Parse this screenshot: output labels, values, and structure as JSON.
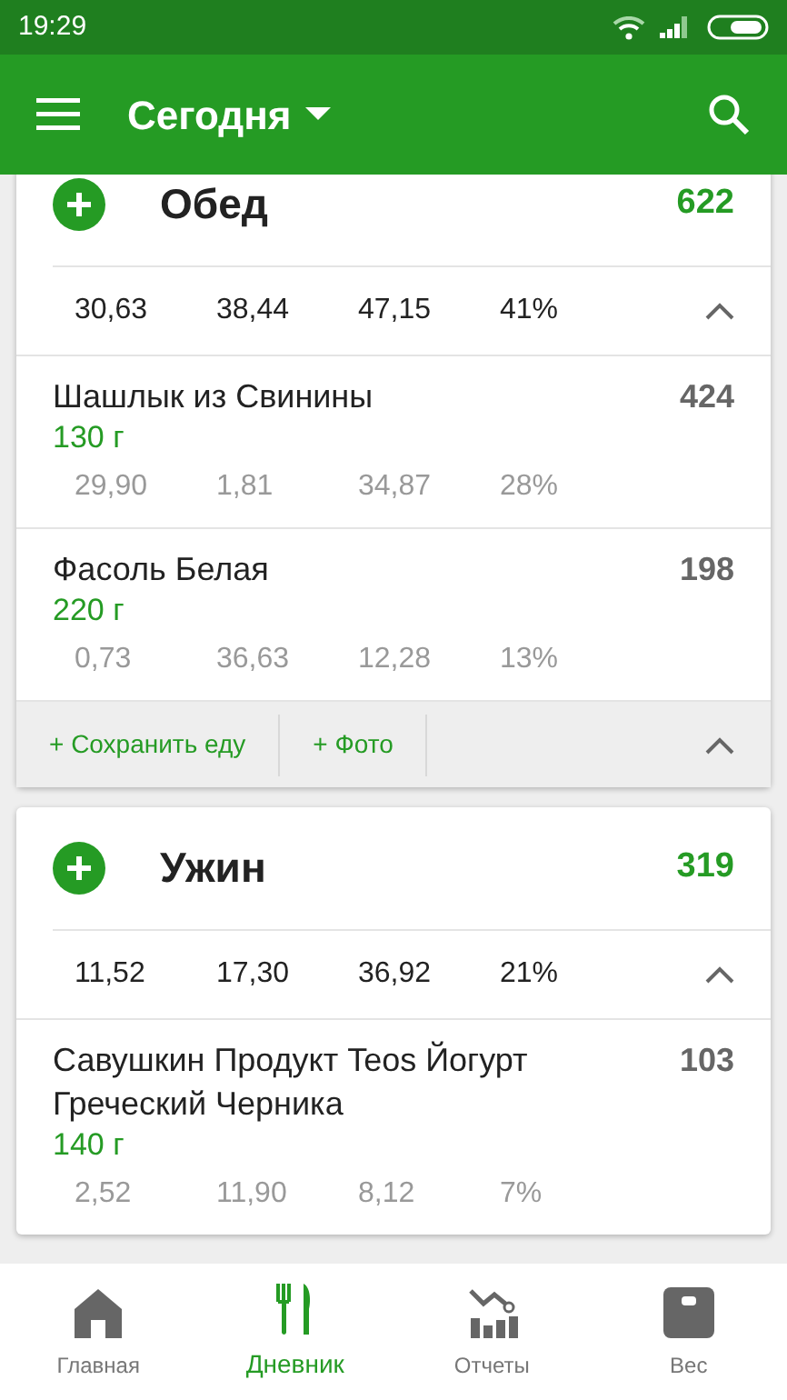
{
  "status_bar": {
    "time": "19:29"
  },
  "app_bar": {
    "title": "Сегодня"
  },
  "meals": [
    {
      "name": "Обед",
      "calories": "622",
      "totals": [
        "30,63",
        "38,44",
        "47,15",
        "41%"
      ],
      "expanded": true,
      "items": [
        {
          "name": "Шашлык из Свинины",
          "amount": "130  г",
          "calories": "424",
          "macros": [
            "29,90",
            "1,81",
            "34,87",
            "28%"
          ]
        },
        {
          "name": "Фасоль Белая",
          "amount": "220  г",
          "calories": "198",
          "macros": [
            "0,73",
            "36,63",
            "12,28",
            "13%"
          ]
        }
      ],
      "actions": [
        "+ Сохранить еду",
        "+ Фото"
      ]
    },
    {
      "name": "Ужин",
      "calories": "319",
      "totals": [
        "11,52",
        "17,30",
        "36,92",
        "21%"
      ],
      "expanded": true,
      "items": [
        {
          "name": "Савушкин Продукт Teos Йогурт Греческий Черника",
          "amount": "140  г",
          "calories": "103",
          "macros": [
            "2,52",
            "11,90",
            "8,12",
            "7%"
          ]
        }
      ]
    }
  ],
  "bottom_nav": [
    {
      "kind": "home",
      "label": "Главная",
      "selected": false
    },
    {
      "kind": "diary",
      "label": "Дневник",
      "selected": true
    },
    {
      "kind": "reports",
      "label": "Отчеты",
      "selected": false
    },
    {
      "kind": "weight",
      "label": "Вес",
      "selected": false
    }
  ]
}
